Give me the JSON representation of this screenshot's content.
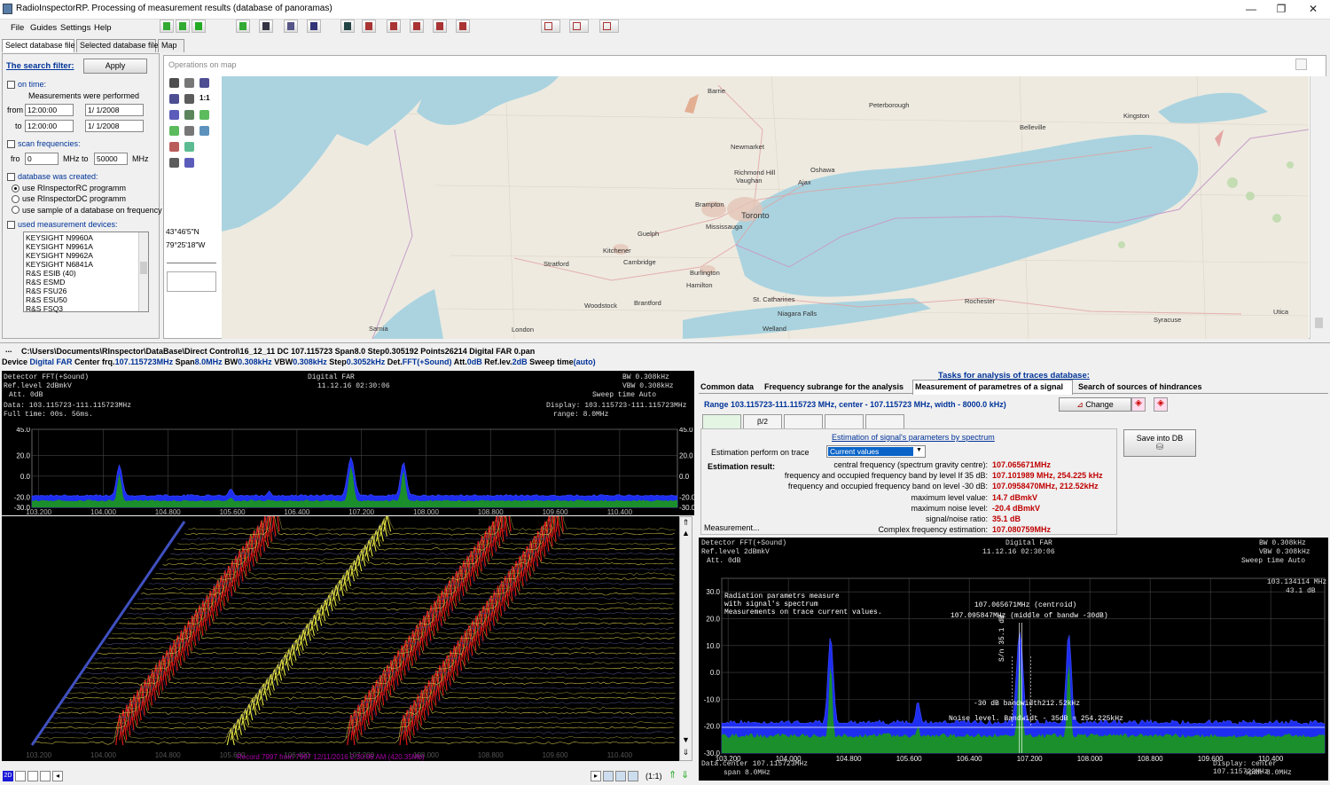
{
  "window": {
    "title": "RadioInspectorRP. Processing of measurement results (database of panoramas)",
    "controls": [
      "—",
      "❐",
      "✕"
    ]
  },
  "menu": [
    "File",
    "Guides",
    "Settings",
    "Help"
  ],
  "tabs": [
    "Select database file",
    "Selected database file",
    "Map"
  ],
  "filter": {
    "title": "The search filter:",
    "apply": "Apply",
    "on_time": "on time:",
    "measured_label": "Measurements were performed",
    "from_label": "from",
    "to_label": "to",
    "from_time": "12:00:00",
    "to_time": "12:00:00",
    "from_date": "1/  1/2008",
    "to_date": "1/  1/2008",
    "scan_freq": "scan frequencies:",
    "fro_label": "fro",
    "mhz_to": "MHz to",
    "mhz": "MHz",
    "freq_from": "0",
    "freq_to": "50000",
    "db_created": "database was created:",
    "radio": [
      "use RInspectorRC programm",
      "use RInspectorDC programm",
      "use sample of a database on frequency"
    ],
    "devices_label": "used measurement devices:",
    "devices": [
      "KEYSIGHT N9960A",
      "KEYSIGHT N9961A",
      "KEYSIGHT N9962A",
      "KEYSIGHT N6841A",
      "R&S ESIB (40)",
      "R&S ESMD",
      "R&S FSU26",
      "R&S ESU50",
      "R&S FSQ3"
    ]
  },
  "map": {
    "ops_label": "Operations on map",
    "coords": [
      "43°46'5\"N",
      "79°25'18\"W"
    ],
    "one_to_one": "1:1",
    "places": [
      "Barrie",
      "Peterborough",
      "Kingston",
      "Belleville",
      "Newmarket",
      "Oshawa",
      "Richmond Hill",
      "Vaughan",
      "Ajax",
      "Brampton",
      "Toronto",
      "Mississauga",
      "Guelph",
      "Kitchener",
      "Cambridge",
      "Stratford",
      "Burlington",
      "Hamilton",
      "Brantford",
      "Woodstock",
      "St. Catharines",
      "Niagara Falls",
      "Rochester",
      "Syracuse",
      "Utica",
      "London",
      "Sarnia",
      "Welland"
    ]
  },
  "file": {
    "path": "C:\\Users\\Documents\\RInspector\\DataBase\\Direct Control\\16_12_11 DC 107.115723 Span8.0 Step0.305192 Points26214 Digital FAR 0.pan",
    "device_line": [
      {
        "k": "Device ",
        "v": "Digital FAR"
      },
      {
        "k": "  Center frq.",
        "v": "107.115723MHz"
      },
      {
        "k": "  Span",
        "v": "8.0MHz"
      },
      {
        "k": "  BW",
        "v": "0.308kHz"
      },
      {
        "k": "  VBW",
        "v": "0.308kHz"
      },
      {
        "k": "  Step",
        "v": "0.3052kHz"
      },
      {
        "k": "  Det.",
        "v": "FFT(+Sound)"
      },
      {
        "k": "  Att.",
        "v": "0dB"
      },
      {
        "k": "  Ref.lev.",
        "v": "2dB"
      },
      {
        "k": "  Sweep time",
        "v": "(auto)"
      }
    ]
  },
  "left_spectrum": {
    "detector": "Detector FFT(+Sound)",
    "ref": "Ref.level 2dBmkV",
    "att": "Att. 0dB",
    "device": "Digital FAR",
    "time": "11.12.16 02:30:06",
    "bw": "BW  0.308kHz",
    "vbw": "VBW  0.308kHz",
    "sweep": "Sweep time  Auto",
    "data": "Data:    103.115723-111.115723MHz",
    "fulltime": "Full time:  00s. 56ms.",
    "display": "Display:   103.115723-111.115723MHz",
    "range": "range: 8.0MHz",
    "yticks": [
      "45.0",
      "20.0",
      "0.0",
      "-20.0",
      "-30.0"
    ],
    "xticks": [
      "103.200",
      "104.000",
      "104.800",
      "105.600",
      "106.400",
      "107.200",
      "108.000",
      "108.800",
      "109.600",
      "110.400"
    ]
  },
  "waterfall": {
    "record": "Record 7997  from 7997   12/11/2016 2:30:06 AM (420.35Mb)",
    "xticks": [
      "103.200",
      "104.000",
      "104.800",
      "105.600",
      "106.400",
      "107.200",
      "108.000",
      "108.800",
      "109.600",
      "110.400"
    ],
    "zoom": "(1:1)",
    "mode": "2D"
  },
  "tasks": {
    "title": "Tasks for analysis of traces database:",
    "tabs": [
      "Common data",
      "Frequency subrange for the analysis",
      "Measurement of parametres of a signal",
      "Search of sources of hindrances"
    ],
    "range": "Range 103.115723-111.115723 MHz, center - 107.115723 MHz, width - 8000.0 kHz)",
    "change": "Change",
    "subtabs": [
      "",
      "β/2",
      "",
      "",
      ""
    ],
    "estimation_title": "Estimation of signal's parameters by spectrum",
    "perform_label": "Estimation perform on trace",
    "trace": "Current values",
    "result_label": "Estimation result:",
    "save": "Save into DB",
    "measurement": "Measurement...",
    "results": [
      {
        "label": "central frequency (spectrum gravity centre):",
        "value": "107.065671MHz"
      },
      {
        "label": "frequency and occupied frequency band by level If 35 dB:",
        "value": "107.101989 MHz,  254.225 kHz"
      },
      {
        "label": "frequency and occupied frequency band on level -30 dB:",
        "value": "107.0958470MHz,  212.52kHz"
      },
      {
        "label": "maximum level value:",
        "value": "14.7 dBmkV"
      },
      {
        "label": "maximum noise level:",
        "value": "-20.4 dBmkV"
      },
      {
        "label": "signal/noise ratio:",
        "value": "35.1 dB"
      },
      {
        "label": "Complex frequency estimation:",
        "value": "107.080759MHz"
      }
    ]
  },
  "right_spectrum": {
    "detector": "Detector FFT(+Sound)",
    "ref": "Ref.level 2dBmkV",
    "att": "Att. 0dB",
    "device": "Digital FAR",
    "time": "11.12.16 02:30:06",
    "bw": "BW  0.308kHz",
    "vbw": "VBW  0.308kHz",
    "sweep": "Sweep time  Auto",
    "marker_f": "103.134114 MHz",
    "marker_l": "43.1 dB",
    "notes": [
      "Radiation parametrs measure",
      "with signal's spectrum",
      "Measurements on trace current values."
    ],
    "centroid": "107.065671MHz (centroid)",
    "middle": "107.095847MHz (middle of bandw -30dB)",
    "bw30": "-30 dB bandwidth212.52kHz",
    "snr": "S/n 35.1 dB",
    "noise": "Noise level. Bandwidt - 35dB = 254.225kHz",
    "yticks": [
      "30.0",
      "20.0",
      "10.0",
      "0.0",
      "-10.0",
      "-20.0",
      "-30.0"
    ],
    "xticks": [
      "103.200",
      "104.000",
      "104.800",
      "105.600",
      "106.400",
      "107.200",
      "108.000",
      "108.800",
      "109.600",
      "110.400"
    ],
    "datacenter": "Data.center  107.115723MHz",
    "span": "span 8.0MHz",
    "dispcenter": "Display:  center  107.115723MHz",
    "span2": "span 8.0MHz"
  }
}
